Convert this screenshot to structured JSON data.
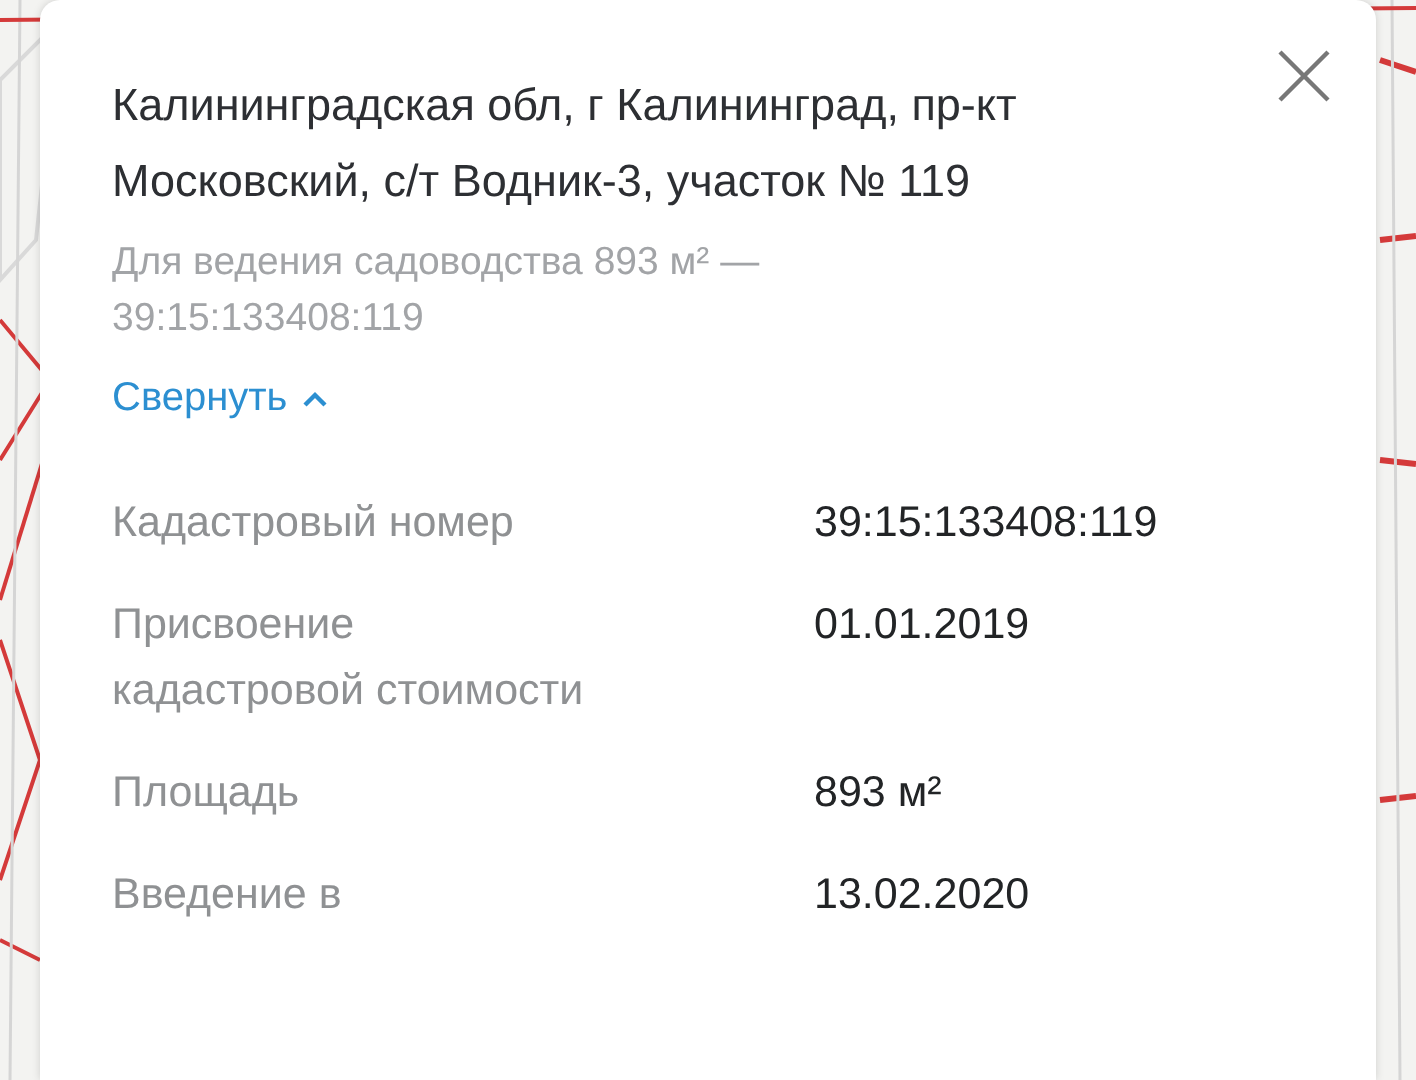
{
  "card": {
    "title": "Калининградская обл, г Калининград, пр-кт Московский, с/т Водник-3, участок № 119",
    "subtitle": "Для ведения садоводства 893 м² — 39:15:133408:119",
    "collapse_link": "Свернуть",
    "details": [
      {
        "label": "Кадастровый номер",
        "value": "39:15:133408:119"
      },
      {
        "label": "Присвоение кадастровой стоимости",
        "value": "01.01.2019"
      },
      {
        "label": "Площадь",
        "value": "893 м²"
      },
      {
        "label": "Введение в",
        "value": "13.02.2020"
      }
    ]
  }
}
